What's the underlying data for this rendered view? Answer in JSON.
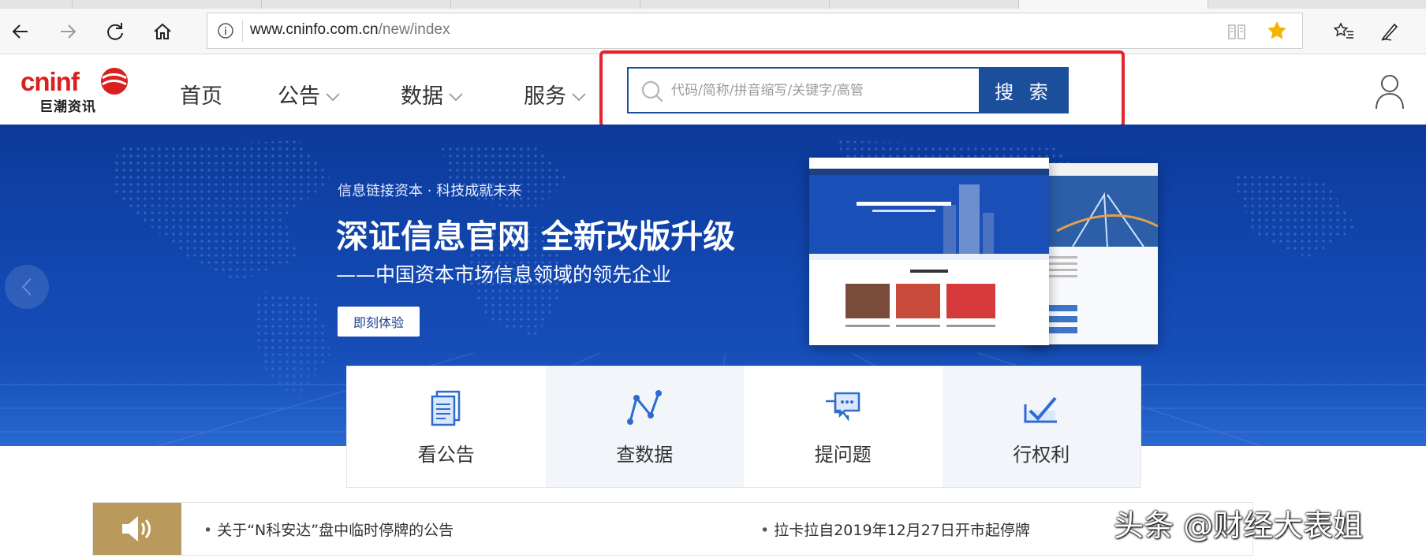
{
  "browser": {
    "url_domain": "www.cninfo.com.cn",
    "url_path": "/new/index",
    "favorite_color": "#f4b400"
  },
  "header": {
    "logo_text": "cninf",
    "logo_cn": "巨潮资讯",
    "nav": [
      {
        "label": "首页",
        "has_dropdown": false
      },
      {
        "label": "公告",
        "has_dropdown": true
      },
      {
        "label": "数据",
        "has_dropdown": true
      },
      {
        "label": "服务",
        "has_dropdown": true
      }
    ],
    "search": {
      "placeholder": "代码/简称/拼音缩写/关键字/高管",
      "button_label": "搜 索"
    },
    "accent_color": "#1b4f9c",
    "highlight_color": "#e4242a"
  },
  "hero": {
    "tagline": "信息链接资本 · 科技成就未来",
    "title": "深证信息官网 全新改版升级",
    "subtitle": "——中国资本市场信息领域的领先企业",
    "cta_label": "即刻体验"
  },
  "tiles": [
    {
      "label": "看公告",
      "icon": "document-icon"
    },
    {
      "label": "查数据",
      "icon": "line-chart-icon"
    },
    {
      "label": "提问题",
      "icon": "chat-bubble-icon"
    },
    {
      "label": "行权利",
      "icon": "check-chart-icon"
    }
  ],
  "notices": [
    "关于“N科安达”盘中临时停牌的公告",
    "拉卡拉自2019年12月27日开市起停牌"
  ],
  "watermark": "头条 @财经大表姐"
}
